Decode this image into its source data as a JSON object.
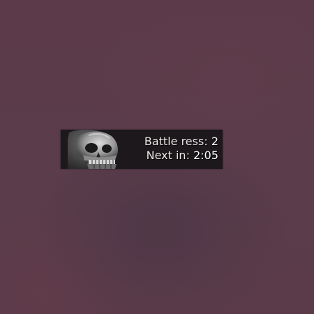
{
  "battle_res": {
    "charges_label": "Battle ress:",
    "charges_value": "2",
    "next_label": "Next in:",
    "next_value": "2:05",
    "icon": "skull-icon"
  },
  "colors": {
    "background": "#5a3b48",
    "panel": "#1c181b",
    "text": "#eae6e6"
  }
}
